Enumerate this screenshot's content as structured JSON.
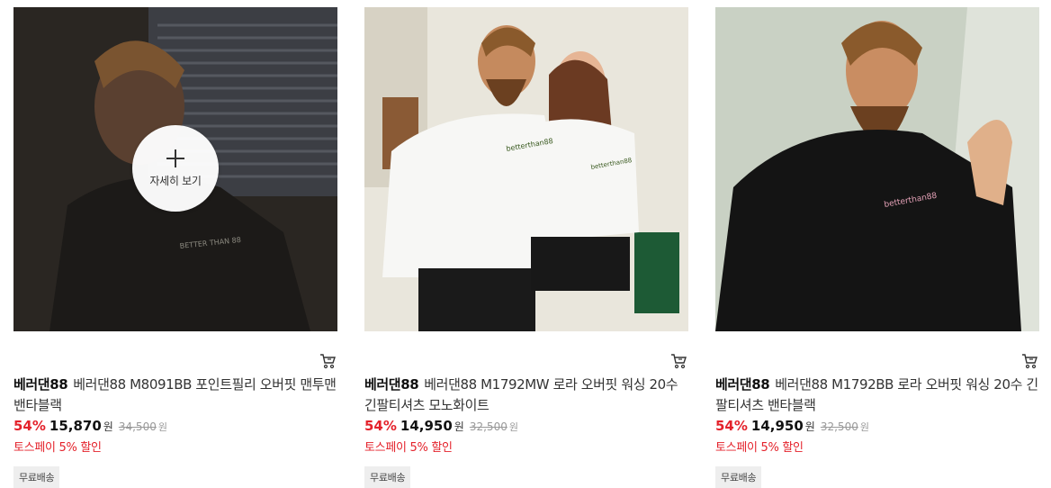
{
  "overlay": {
    "detail_label": "자세히 보기"
  },
  "products": [
    {
      "brand": "베러댄88",
      "name": "베러댄88 M8091BB 포인트필리 오버핏 맨투맨 밴타블랙",
      "discount": "54%",
      "price": "15,870",
      "currency": "원",
      "original_price": "34,500",
      "toss": "토스페이 5% 할인",
      "badge": "무료배송",
      "image_text": "BETTER THAN 88"
    },
    {
      "brand": "베러댄88",
      "name": "베러댄88 M1792MW 로라 오버핏 워싱 20수 긴팔티셔츠 모노화이트",
      "discount": "54%",
      "price": "14,950",
      "currency": "원",
      "original_price": "32,500",
      "toss": "토스페이 5% 할인",
      "badge": "무료배송",
      "image_text": "betterthan88"
    },
    {
      "brand": "베러댄88",
      "name": "베러댄88 M1792BB 로라 오버핏 워싱 20수 긴팔티셔츠 밴타블랙",
      "discount": "54%",
      "price": "14,950",
      "currency": "원",
      "original_price": "32,500",
      "toss": "토스페이 5% 할인",
      "badge": "무료배송",
      "image_text": "betterthan88"
    }
  ],
  "icons": {
    "cart": "cart-icon",
    "detail": "plus-icon"
  },
  "colors": {
    "discount": "#e4222b",
    "badge_bg": "#eeeeee"
  }
}
